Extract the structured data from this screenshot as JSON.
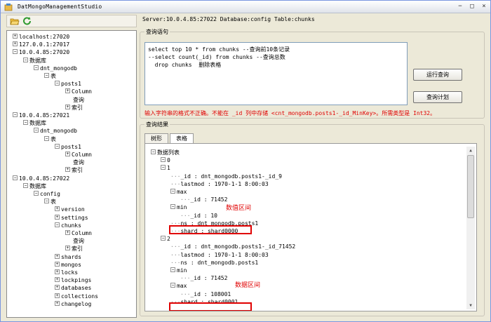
{
  "window": {
    "title": "DatMongoManagementStudio",
    "minimize": "−",
    "maximize": "□",
    "close": "×"
  },
  "toolbar": {
    "open_icon": "folder-open-icon",
    "refresh_icon": "refresh-icon"
  },
  "tree": [
    {
      "label": "localhost:27020",
      "indent": 0,
      "exp": "+"
    },
    {
      "label": "127.0.0.1:27017",
      "indent": 0,
      "exp": "+"
    },
    {
      "label": "10.0.4.85:27020",
      "indent": 0,
      "exp": "−"
    },
    {
      "label": "数据库",
      "indent": 1,
      "exp": "−"
    },
    {
      "label": "dnt_mongodb",
      "indent": 2,
      "exp": "−"
    },
    {
      "label": "表",
      "indent": 3,
      "exp": "−"
    },
    {
      "label": "posts1",
      "indent": 4,
      "exp": "−"
    },
    {
      "label": "Column",
      "indent": 5,
      "exp": "+"
    },
    {
      "label": "查询",
      "indent": 5,
      "exp": ""
    },
    {
      "label": "索引",
      "indent": 5,
      "exp": "+"
    },
    {
      "label": "10.0.4.85:27021",
      "indent": 0,
      "exp": "−"
    },
    {
      "label": "数据库",
      "indent": 1,
      "exp": "−"
    },
    {
      "label": "dnt_mongodb",
      "indent": 2,
      "exp": "−"
    },
    {
      "label": "表",
      "indent": 3,
      "exp": "−"
    },
    {
      "label": "posts1",
      "indent": 4,
      "exp": "−"
    },
    {
      "label": "Column",
      "indent": 5,
      "exp": "+"
    },
    {
      "label": "查询",
      "indent": 5,
      "exp": ""
    },
    {
      "label": "索引",
      "indent": 5,
      "exp": "+"
    },
    {
      "label": "10.0.4.85:27022",
      "indent": 0,
      "exp": "−"
    },
    {
      "label": "数据库",
      "indent": 1,
      "exp": "−"
    },
    {
      "label": "config",
      "indent": 2,
      "exp": "−"
    },
    {
      "label": "表",
      "indent": 3,
      "exp": "−"
    },
    {
      "label": "version",
      "indent": 4,
      "exp": "+"
    },
    {
      "label": "settings",
      "indent": 4,
      "exp": "+"
    },
    {
      "label": "chunks",
      "indent": 4,
      "exp": "−"
    },
    {
      "label": "Column",
      "indent": 5,
      "exp": "+"
    },
    {
      "label": "查询",
      "indent": 5,
      "exp": ""
    },
    {
      "label": "索引",
      "indent": 5,
      "exp": "+"
    },
    {
      "label": "shards",
      "indent": 4,
      "exp": "+"
    },
    {
      "label": "mongos",
      "indent": 4,
      "exp": "+"
    },
    {
      "label": "locks",
      "indent": 4,
      "exp": "+"
    },
    {
      "label": "lockpings",
      "indent": 4,
      "exp": "+"
    },
    {
      "label": "databases",
      "indent": 4,
      "exp": "+"
    },
    {
      "label": "collections",
      "indent": 4,
      "exp": "+"
    },
    {
      "label": "changelog",
      "indent": 4,
      "exp": "+"
    }
  ],
  "server_info": "Server:10.0.4.85:27022 Database:config Table:chunks",
  "query": {
    "group_title": "查询语句",
    "lines": [
      "select top 10 * from chunks --查询前10条记录",
      "--select count(_id) from chunks --查询总数",
      "  drop chunks  删除表格"
    ],
    "run_button": "运行查询",
    "plan_button": "查询计划",
    "error": "输入字符串的格式不正确。不能在 _id 列中存储 <cnt_mongodb.posts1-_id_MinKey>。所需类型是 Int32。"
  },
  "results": {
    "group_title": "查询结果",
    "tabs": [
      "树形",
      "表格"
    ],
    "rows": [
      {
        "text": "数据列表",
        "indent": 0,
        "exp": "−"
      },
      {
        "text": "0",
        "indent": 1,
        "exp": "−"
      },
      {
        "text": "1",
        "indent": 1,
        "exp": "−"
      },
      {
        "text": "_id : dnt_mongodb.posts1-_id_9",
        "indent": 2,
        "exp": ""
      },
      {
        "text": "lastmod : 1970-1-1 8:00:03",
        "indent": 2,
        "exp": ""
      },
      {
        "text": "max",
        "indent": 2,
        "exp": "−"
      },
      {
        "text": "_id : 71452",
        "indent": 3,
        "exp": ""
      },
      {
        "text": "min",
        "indent": 2,
        "exp": "−"
      },
      {
        "text": "_id : 10",
        "indent": 3,
        "exp": ""
      },
      {
        "text": "ns : dnt_mongodb.posts1",
        "indent": 2,
        "exp": ""
      },
      {
        "text": "shard : shard0000",
        "indent": 2,
        "exp": ""
      },
      {
        "text": "2",
        "indent": 1,
        "exp": "−"
      },
      {
        "text": "_id : dnt_mongodb.posts1-_id_71452",
        "indent": 2,
        "exp": ""
      },
      {
        "text": "lastmod : 1970-1-1 8:00:03",
        "indent": 2,
        "exp": ""
      },
      {
        "text": "ns : dnt_mongodb.posts1",
        "indent": 2,
        "exp": ""
      },
      {
        "text": "min",
        "indent": 2,
        "exp": "−"
      },
      {
        "text": "_id : 71452",
        "indent": 3,
        "exp": ""
      },
      {
        "text": "max",
        "indent": 2,
        "exp": "−"
      },
      {
        "text": "_id : 108001",
        "indent": 3,
        "exp": ""
      },
      {
        "text": "shard : shard0001",
        "indent": 2,
        "exp": ""
      }
    ]
  },
  "annotations": {
    "range1": "数值区间",
    "range2": "数据区间"
  }
}
